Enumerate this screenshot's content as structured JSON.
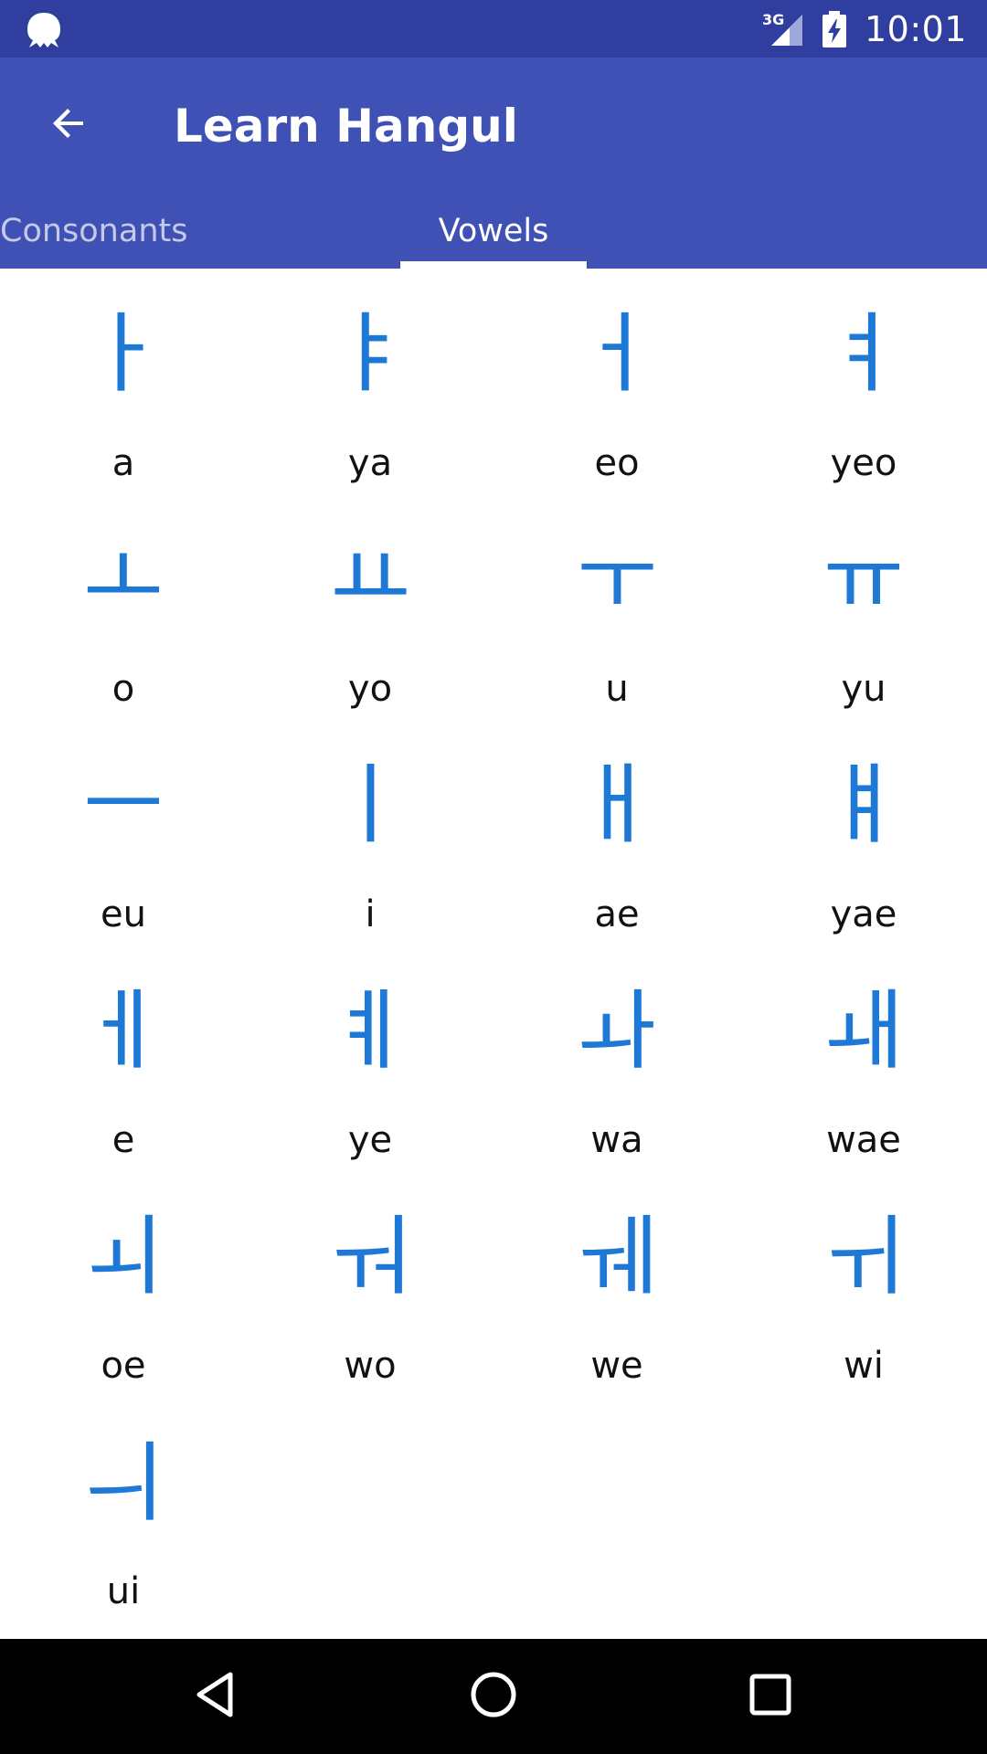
{
  "status_bar": {
    "network_label": "3G",
    "time": "10:01",
    "notification_icon": "octopus-icon",
    "signal_icon": "signal-icon",
    "battery_icon": "battery-charging-icon"
  },
  "app_bar": {
    "back_icon": "arrow-back-icon",
    "title": "Learn Hangul"
  },
  "tabs": [
    {
      "label": "Consonants",
      "selected": false
    },
    {
      "label": "Vowels",
      "selected": true
    }
  ],
  "vowels": [
    {
      "hangul": "ㅏ",
      "roman": "a"
    },
    {
      "hangul": "ㅑ",
      "roman": "ya"
    },
    {
      "hangul": "ㅓ",
      "roman": "eo"
    },
    {
      "hangul": "ㅕ",
      "roman": "yeo"
    },
    {
      "hangul": "ㅗ",
      "roman": "o"
    },
    {
      "hangul": "ㅛ",
      "roman": "yo"
    },
    {
      "hangul": "ㅜ",
      "roman": "u"
    },
    {
      "hangul": "ㅠ",
      "roman": "yu"
    },
    {
      "hangul": "ㅡ",
      "roman": "eu"
    },
    {
      "hangul": "ㅣ",
      "roman": "i"
    },
    {
      "hangul": "ㅐ",
      "roman": "ae"
    },
    {
      "hangul": "ㅒ",
      "roman": "yae"
    },
    {
      "hangul": "ㅔ",
      "roman": "e"
    },
    {
      "hangul": "ㅖ",
      "roman": "ye"
    },
    {
      "hangul": "ㅘ",
      "roman": "wa"
    },
    {
      "hangul": "ㅙ",
      "roman": "wae"
    },
    {
      "hangul": "ㅚ",
      "roman": "oe"
    },
    {
      "hangul": "ㅝ",
      "roman": "wo"
    },
    {
      "hangul": "ㅞ",
      "roman": "we"
    },
    {
      "hangul": "ㅟ",
      "roman": "wi"
    },
    {
      "hangul": "ㅢ",
      "roman": "ui"
    }
  ],
  "nav_bar": {
    "back_icon": "nav-back-icon",
    "home_icon": "nav-home-icon",
    "recents_icon": "nav-recents-icon"
  },
  "colors": {
    "status_bar": "#303F9F",
    "app_bar": "#3F51B5",
    "glyph": "#1E78D6",
    "inactive_tab": "#C5CAE9"
  }
}
